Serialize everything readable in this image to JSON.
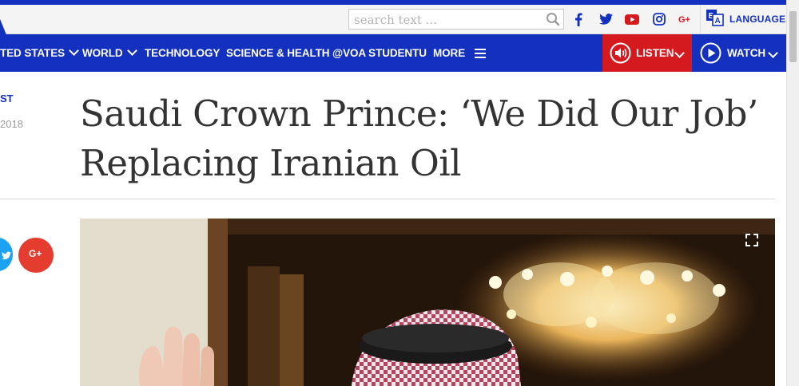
{
  "header": {
    "search_placeholder": "search text ...",
    "languages_label": "LANGUAGES",
    "social_icons": [
      "facebook-icon",
      "twitter-icon",
      "youtube-icon",
      "instagram-icon",
      "google-plus-icon"
    ]
  },
  "nav": {
    "items": [
      {
        "label": "TED STATES",
        "has_dropdown": true
      },
      {
        "label": "WORLD",
        "has_dropdown": true
      },
      {
        "label": "TECHNOLOGY",
        "has_dropdown": false
      },
      {
        "label": "SCIENCE & HEALTH",
        "has_dropdown": false
      },
      {
        "label": "@VOA STUDENTU",
        "has_dropdown": false
      },
      {
        "label": "MORE",
        "has_dropdown": false
      }
    ],
    "listen_label": "LISTEN",
    "watch_label": "WATCH"
  },
  "article": {
    "category": "ST",
    "date": "2018",
    "headline_line1": "Saudi Crown Prince: ‘We Did Our Job’",
    "headline_line2": "Replacing Iranian Oil"
  },
  "colors": {
    "brand_blue": "#1330bf",
    "listen_red": "#d41a1f",
    "headline_text": "#333333",
    "google_red": "#e43c2f",
    "twitter_blue": "#1da1f2"
  }
}
